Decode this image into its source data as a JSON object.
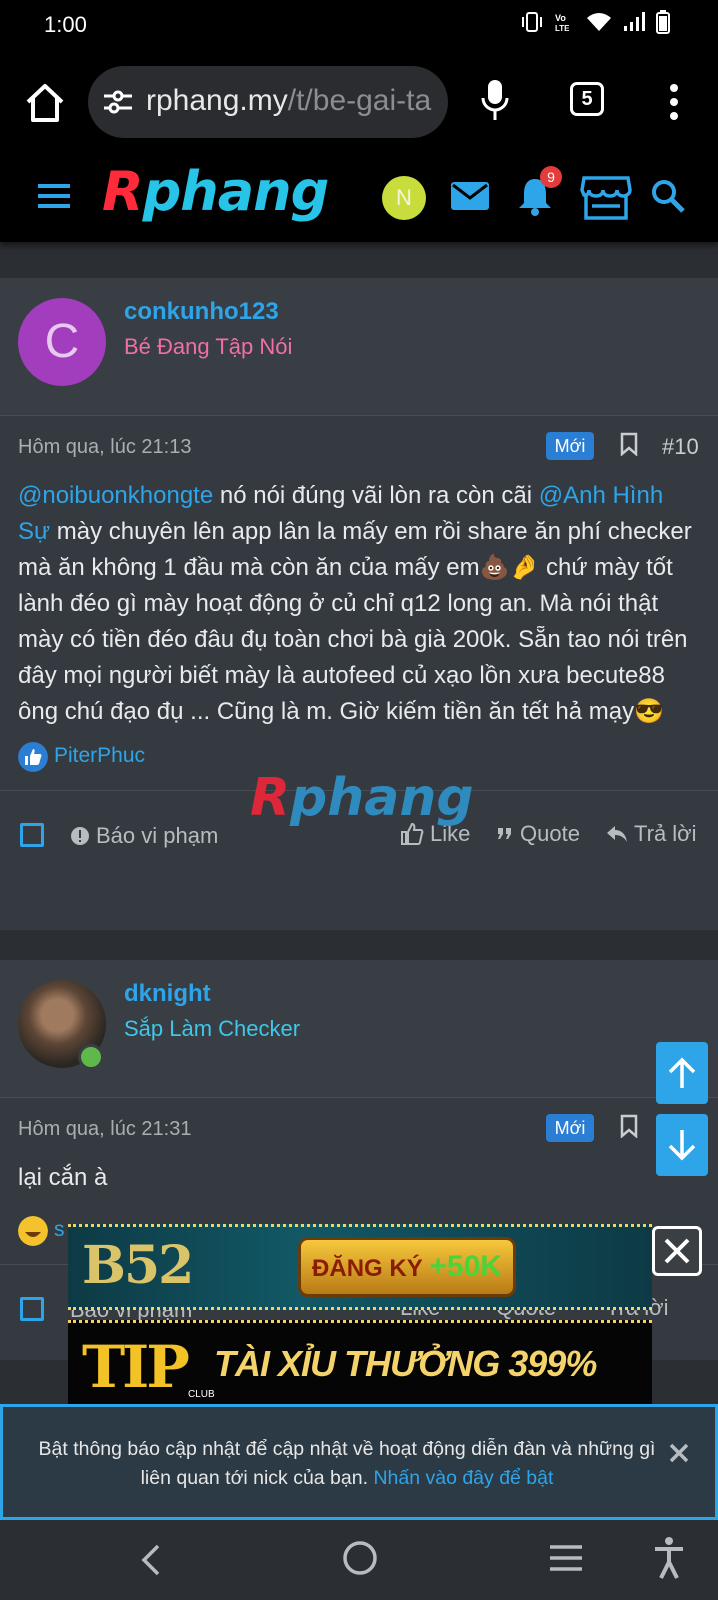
{
  "status_bar": {
    "time": "1:00"
  },
  "browser": {
    "url_domain": "rphang.my",
    "url_path": "/t/be-gai-ta",
    "tab_count": "5"
  },
  "site": {
    "logo_first": "R",
    "logo_rest": "phang",
    "user_initial": "N",
    "notification_count": "9"
  },
  "posts": [
    {
      "author": "conkunho123",
      "author_title": "Bé Đang Tập Nói",
      "author_title_color": "#f06fa8",
      "avatar_letter": "C",
      "avatar_color": "#a23dbd",
      "date": "Hôm qua, lúc 21:13",
      "badge": "Mới",
      "number": "#10",
      "body": {
        "mention1": "@noibuonkhongte",
        "text1": " nó nói đúng vãi lòn ra còn cãi ",
        "mention2": "@Anh Hình Sự",
        "text2": " mày chuyên lên app lân la mấy em rồi share ăn phí checker mà ăn không 1 đầu mà còn ăn của mấy em💩🤌 chứ mày tốt lành đéo gì mày hoạt động ở củ chỉ q12 long an. Mà nói thật mày có tiền đéo đâu đụ toàn chơi bà già 200k. Sẵn tao nói trên đây mọi người biết mày là autofeed củ xạo lồn xưa becute88 ông chú đạo đụ ... Cũng là m. Giờ kiếm tiền ăn tết hả mạy😎"
      },
      "reaction_user": "PiterPhuc"
    },
    {
      "author": "dknight",
      "author_title": "Sắp Làm Checker",
      "author_title_color": "#3fc6e8",
      "date": "Hôm qua, lúc 21:31",
      "badge": "Mới",
      "body_text": "lại cắn à",
      "reaction_user": "s"
    }
  ],
  "actions": {
    "report": "Báo vi phạm",
    "like": "Like",
    "quote": "Quote",
    "reply": "Trả lời"
  },
  "ads": {
    "ad1_brand": "B52",
    "ad1_button_text": "ĐĂNG KÝ ",
    "ad1_button_amount": "+50K",
    "ad2_brand": "TIP",
    "ad2_brand_sub": "CLUB",
    "ad2_text": "TÀI XỈU THƯỞNG 399%"
  },
  "notification": {
    "message": "Bật thông báo cập nhật để cập nhật về hoạt động diễn đàn và những gì liên quan tới nick của bạn. ",
    "link": "Nhấn vào đây để bật"
  },
  "colors": {
    "accent": "#2ea4e9",
    "badge": "#2a7fd4",
    "background": "#2b2f33"
  }
}
